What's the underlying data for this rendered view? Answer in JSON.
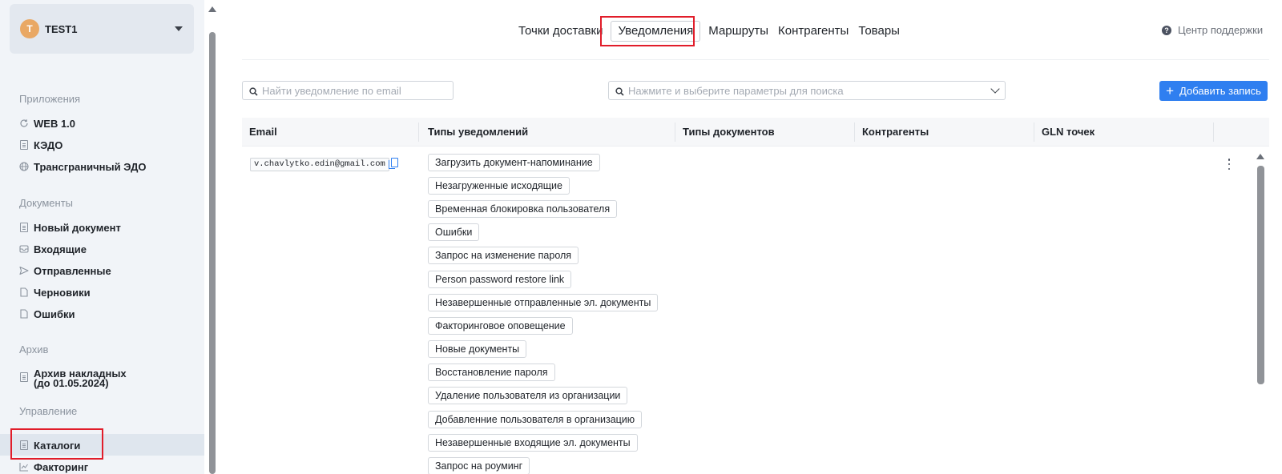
{
  "org": {
    "avatar_letter": "T",
    "name": "TEST1"
  },
  "sidebar": {
    "sections": [
      {
        "title": "Приложения",
        "items": [
          {
            "label": "WEB 1.0",
            "icon": "refresh-icon"
          },
          {
            "label": "КЭДО",
            "icon": "document-icon"
          },
          {
            "label": "Трансграничный ЭДО",
            "icon": "globe-icon"
          }
        ]
      },
      {
        "title": "Документы",
        "items": [
          {
            "label": "Новый документ",
            "icon": "new-document-icon"
          },
          {
            "label": "Входящие",
            "icon": "inbox-icon"
          },
          {
            "label": "Отправленные",
            "icon": "send-icon"
          },
          {
            "label": "Черновики",
            "icon": "draft-icon"
          },
          {
            "label": "Ошибки",
            "icon": "error-document-icon"
          }
        ]
      },
      {
        "title": "Архив",
        "items": [
          {
            "label_line1": "Архив накладных",
            "label_line2": "(до 01.05.2024)",
            "icon": "archive-icon"
          }
        ]
      },
      {
        "title": "Управление",
        "items": [
          {
            "label": "Каталоги",
            "icon": "catalog-icon",
            "active": true
          },
          {
            "label": "Факторинг",
            "icon": "chart-icon"
          }
        ]
      }
    ]
  },
  "tabs": [
    {
      "label": "Точки доставки"
    },
    {
      "label": "Уведомления",
      "active": true
    },
    {
      "label": "Маршруты"
    },
    {
      "label": "Контрагенты"
    },
    {
      "label": "Товары"
    }
  ],
  "support": {
    "label": "Центр поддержки"
  },
  "filters": {
    "email_search_placeholder": "Найти уведомление по email",
    "params_search_placeholder": "Нажмите и выберите параметры для поиска",
    "add_button_label": "Добавить запись"
  },
  "table": {
    "columns": [
      "Email",
      "Типы уведомлений",
      "Типы документов",
      "Контрагенты",
      "GLN точек"
    ],
    "rows": [
      {
        "email": "v.chavlytko.edin@gmail.com",
        "notification_types": [
          "Загрузить документ-напоминание",
          "Незагруженные исходящие",
          "Временная блокировка пользователя",
          "Ошибки",
          "Запрос на изменение пароля",
          "Person password restore link",
          "Незавершенные отправленные эл. документы",
          "Факторинговое оповещение",
          "Новые документы",
          "Восстановление пароля",
          "Удаление пользователя из организации",
          "Добавленние пользователя в организацию",
          "Незавершенные входящие эл. документы",
          "Запрос на роуминг"
        ]
      }
    ]
  },
  "colors": {
    "accent": "#2f7ff0",
    "sidebar_bg": "#f1f4f8",
    "highlight_border": "#e11d2a",
    "avatar": "#e9a864"
  }
}
